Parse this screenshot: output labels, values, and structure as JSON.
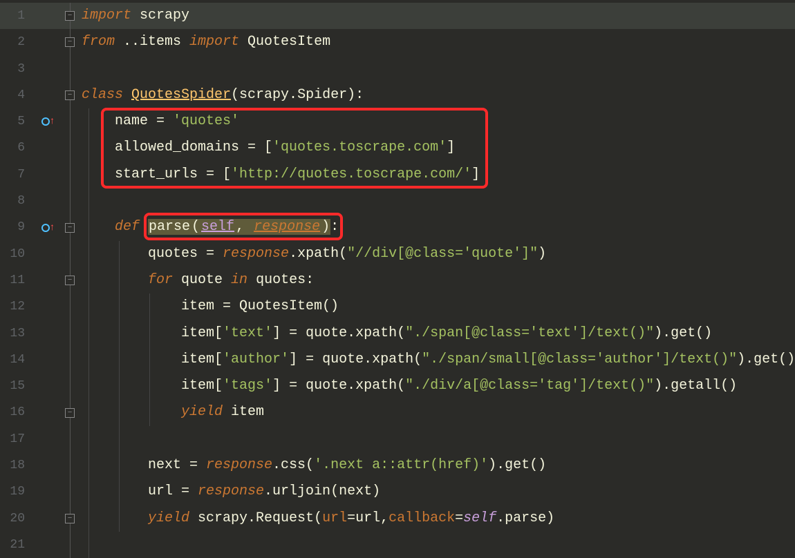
{
  "lines": {
    "n1": "1",
    "n2": "2",
    "n3": "3",
    "n4": "4",
    "n5": "5",
    "n6": "6",
    "n7": "7",
    "n8": "8",
    "n9": "9",
    "n10": "10",
    "n11": "11",
    "n12": "12",
    "n13": "13",
    "n14": "14",
    "n15": "15",
    "n16": "16",
    "n17": "17",
    "n18": "18",
    "n19": "19",
    "n20": "20",
    "n21": "21"
  },
  "code": {
    "l1_import": "import ",
    "l1_scrapy": "scrapy",
    "l2_from": "from ",
    "l2_items": "..items ",
    "l2_import": "import ",
    "l2_quotesitem": "QuotesItem",
    "l4_class": "class ",
    "l4_quotes": "QuotesSpider",
    "l4_rest": "(scrapy.Spider):",
    "l5": "    name = ",
    "l5_str": "'quotes'",
    "l6": "    allowed_domains = [",
    "l6_str": "'quotes.toscrape.com'",
    "l6_end": "]",
    "l7": "    start_urls = [",
    "l7_str": "'http://quotes.toscrape.com/'",
    "l7_end": "]",
    "l9_def": "    def ",
    "l9_parse": "parse",
    "l9_op": "(",
    "l9_self": "self",
    "l9_comma": ", ",
    "l9_resp": "response",
    "l9_cp": ")",
    "l9_colon": ":",
    "l10_a": "        quotes = ",
    "l10_resp": "response",
    "l10_b": ".xpath(",
    "l10_str": "\"//div[@class='quote']\"",
    "l10_c": ")",
    "l11_for": "        for ",
    "l11_quote": "quote ",
    "l11_in": "in ",
    "l11_quotes": "quotes:",
    "l12": "            item = QuotesItem()",
    "l13_a": "            item[",
    "l13_key": "'text'",
    "l13_b": "] = quote.xpath(",
    "l13_str": "\"./span[@class='text']/text()\"",
    "l13_c": ").get()",
    "l14_a": "            item[",
    "l14_key": "'author'",
    "l14_b": "] = quote.xpath(",
    "l14_str": "\"./span/small[@class='author']/text()\"",
    "l14_c": ").get()",
    "l15_a": "            item[",
    "l15_key": "'tags'",
    "l15_b": "] = quote.xpath(",
    "l15_str": "\"./div/a[@class='tag']/text()\"",
    "l15_c": ").getall()",
    "l16_yield": "            yield ",
    "l16_item": "item",
    "l18_a": "        next = ",
    "l18_resp": "response",
    "l18_b": ".css(",
    "l18_str": "'.next a::attr(href)'",
    "l18_c": ").get()",
    "l19_a": "        url = ",
    "l19_resp": "response",
    "l19_b": ".urljoin(next)",
    "l20_yield": "        yield ",
    "l20_a": "scrapy.Request(",
    "l20_url": "url",
    "l20_eq": "=url,",
    "l20_cb": "callback",
    "l20_eq2": "=",
    "l20_self": "self",
    "l20_parse": ".parse)"
  }
}
